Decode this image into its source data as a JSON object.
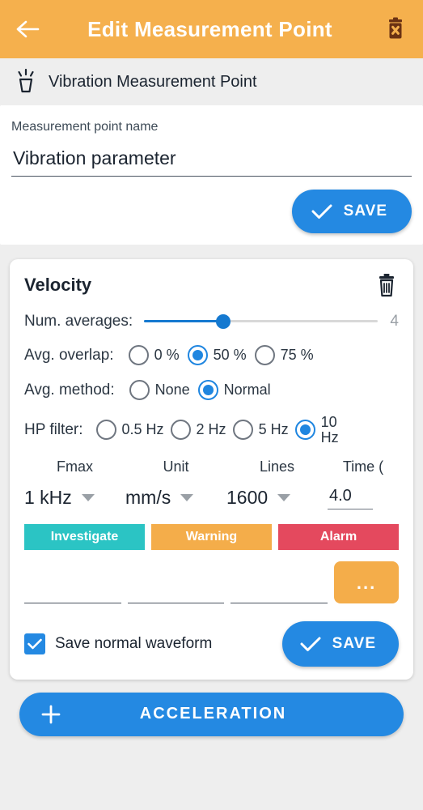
{
  "appbar": {
    "back_icon": "arrow-left-icon",
    "title": "Edit Measurement Point",
    "delete_icon": "trash-delete-icon"
  },
  "subheader": {
    "icon": "vibration-sensor-icon",
    "text": "Vibration Measurement Point"
  },
  "name_card": {
    "label": "Measurement point name",
    "value": "Vibration parameter",
    "placeholder": "Measurement point name",
    "save_label": "SAVE",
    "check_icon": "check-icon"
  },
  "velocity": {
    "title": "Velocity",
    "delete_icon": "trash-icon",
    "num_averages": {
      "label": "Num. averages:",
      "value": "4",
      "percent": 34
    },
    "avg_overlap": {
      "label": "Avg. overlap:",
      "options": [
        "0 %",
        "50 %",
        "75 %"
      ],
      "selected": "50 %"
    },
    "avg_method": {
      "label": "Avg. method:",
      "options": [
        "None",
        "Normal"
      ],
      "selected": "Normal"
    },
    "hp_filter": {
      "label": "HP filter:",
      "options": [
        "0.5 Hz",
        "2 Hz",
        "5 Hz",
        "10 Hz"
      ],
      "selected": "10 Hz"
    },
    "dropdowns": {
      "fmax": {
        "header": "Fmax",
        "value": "1 kHz"
      },
      "unit": {
        "header": "Unit",
        "value": "mm/s"
      },
      "lines": {
        "header": "Lines",
        "value": "1600"
      },
      "time": {
        "header": "Time (",
        "value": "4.0"
      }
    },
    "thresholds": {
      "badges": [
        {
          "label": "Investigate",
          "color": "#2bc4c4"
        },
        {
          "label": "Warning",
          "color": "#f4ad4a"
        },
        {
          "label": "Alarm",
          "color": "#e4495e"
        }
      ],
      "inputs": [
        "",
        "",
        ""
      ],
      "more_label": "...",
      "more_color": "#f4ad4a"
    },
    "save_waveform": {
      "label": "Save normal waveform",
      "checked": true
    },
    "save_label": "SAVE",
    "check_icon": "check-icon"
  },
  "add_button": {
    "plus_icon": "plus-icon",
    "label": "ACCELERATION"
  },
  "colors": {
    "appbar": "#f5b04d",
    "primary": "#2489e2",
    "slider": "#1579d0",
    "background": "#eeeeee"
  }
}
